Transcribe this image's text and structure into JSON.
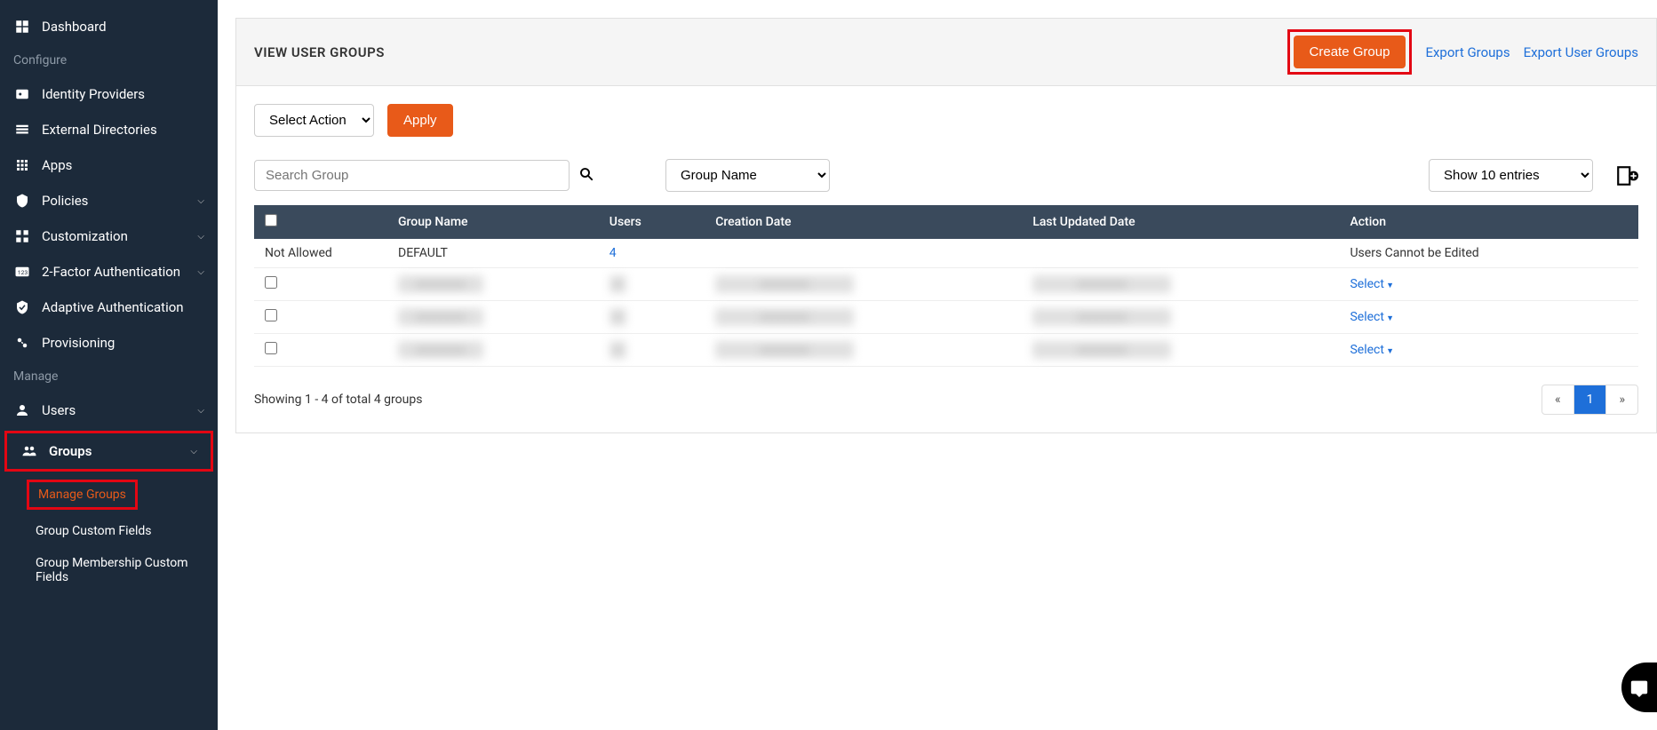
{
  "sidebar": {
    "dashboard": "Dashboard",
    "configure_header": "Configure",
    "identity_providers": "Identity Providers",
    "external_directories": "External Directories",
    "apps": "Apps",
    "policies": "Policies",
    "customization": "Customization",
    "two_factor": "2-Factor Authentication",
    "adaptive_auth": "Adaptive Authentication",
    "provisioning": "Provisioning",
    "manage_header": "Manage",
    "users": "Users",
    "groups": "Groups",
    "manage_groups": "Manage Groups",
    "group_custom_fields": "Group Custom Fields",
    "group_membership_custom": "Group Membership Custom Fields"
  },
  "header": {
    "title": "VIEW USER GROUPS",
    "create_group": "Create Group",
    "export_groups": "Export Groups",
    "export_user_groups": "Export User Groups"
  },
  "controls": {
    "select_action_label": "Select Action",
    "apply": "Apply",
    "search_placeholder": "Search Group",
    "filter_by": "Group Name",
    "entries_label": "Show 10 entries"
  },
  "table": {
    "columns": {
      "group_name": "Group Name",
      "users": "Users",
      "creation_date": "Creation Date",
      "last_updated": "Last Updated Date",
      "action": "Action"
    },
    "rows": [
      {
        "check": "Not Allowed",
        "group_name": "DEFAULT",
        "users": "4",
        "users_link": true,
        "creation_date": "",
        "last_updated": "",
        "action": "Users Cannot be Edited",
        "action_type": "text"
      },
      {
        "check": "box",
        "group_name": "blurred",
        "users": "blurred",
        "creation_date": "blurred",
        "last_updated": "blurred",
        "action": "Select",
        "action_type": "dropdown"
      },
      {
        "check": "box",
        "group_name": "blurred",
        "users": "blurred",
        "creation_date": "blurred",
        "last_updated": "blurred",
        "action": "Select",
        "action_type": "dropdown"
      },
      {
        "check": "box",
        "group_name": "blurred",
        "users": "blurred",
        "creation_date": "blurred",
        "last_updated": "blurred",
        "action": "Select",
        "action_type": "dropdown"
      }
    ]
  },
  "footer": {
    "summary": "Showing 1 - 4 of total 4 groups",
    "prev": "«",
    "page": "1",
    "next": "»"
  }
}
